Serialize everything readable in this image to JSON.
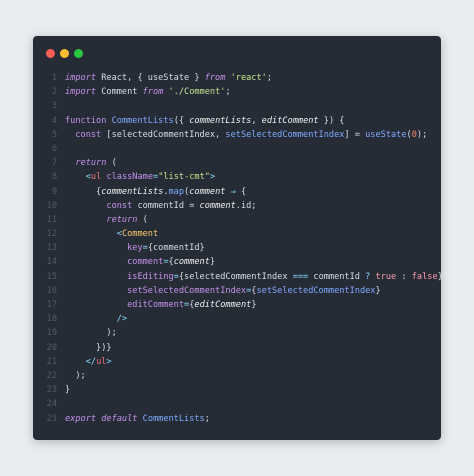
{
  "window": {
    "traffic_lights": [
      {
        "name": "close",
        "color": "#ff5f56"
      },
      {
        "name": "minimize",
        "color": "#ffbd2e"
      },
      {
        "name": "maximize",
        "color": "#27c93f"
      }
    ]
  },
  "code": {
    "lines": [
      {
        "n": "1",
        "tokens": [
          [
            "kw",
            "import"
          ],
          [
            "plain",
            " React, { useState } "
          ],
          [
            "kw",
            "from"
          ],
          [
            "plain",
            " "
          ],
          [
            "str",
            "'react'"
          ],
          [
            "plain",
            ";"
          ]
        ]
      },
      {
        "n": "2",
        "tokens": [
          [
            "kw",
            "import"
          ],
          [
            "plain",
            " Comment "
          ],
          [
            "kw",
            "from"
          ],
          [
            "plain",
            " "
          ],
          [
            "str",
            "'./Comment'"
          ],
          [
            "plain",
            ";"
          ]
        ]
      },
      {
        "n": "3",
        "tokens": []
      },
      {
        "n": "4",
        "tokens": [
          [
            "kw2",
            "function"
          ],
          [
            "plain",
            " "
          ],
          [
            "fn",
            "CommentLists"
          ],
          [
            "plain",
            "({ "
          ],
          [
            "param",
            "commentLists"
          ],
          [
            "plain",
            ", "
          ],
          [
            "param",
            "editComment"
          ],
          [
            "plain",
            " }) {"
          ]
        ]
      },
      {
        "n": "5",
        "tokens": [
          [
            "plain",
            "  "
          ],
          [
            "kw2",
            "const"
          ],
          [
            "plain",
            " [selectedCommentIndex, "
          ],
          [
            "fn",
            "setSelectedCommentIndex"
          ],
          [
            "plain",
            "] = "
          ],
          [
            "fn",
            "useState"
          ],
          [
            "plain",
            "("
          ],
          [
            "num",
            "0"
          ],
          [
            "plain",
            ");"
          ]
        ]
      },
      {
        "n": "6",
        "tokens": []
      },
      {
        "n": "7",
        "tokens": [
          [
            "plain",
            "  "
          ],
          [
            "kw",
            "return"
          ],
          [
            "plain",
            " ("
          ]
        ]
      },
      {
        "n": "8",
        "tokens": [
          [
            "plain",
            "    "
          ],
          [
            "punc",
            "<"
          ],
          [
            "tag",
            "ul"
          ],
          [
            "plain",
            " "
          ],
          [
            "attr",
            "className"
          ],
          [
            "punc",
            "="
          ],
          [
            "str",
            "\"list-cmt\""
          ],
          [
            "punc",
            ">"
          ]
        ]
      },
      {
        "n": "9",
        "tokens": [
          [
            "plain",
            "      {"
          ],
          [
            "param",
            "commentLists"
          ],
          [
            "plain",
            "."
          ],
          [
            "fn",
            "map"
          ],
          [
            "plain",
            "("
          ],
          [
            "param",
            "comment"
          ],
          [
            "plain",
            " "
          ],
          [
            "punc",
            "⇒"
          ],
          [
            "plain",
            " {"
          ]
        ]
      },
      {
        "n": "10",
        "tokens": [
          [
            "plain",
            "        "
          ],
          [
            "kw2",
            "const"
          ],
          [
            "plain",
            " commentId = "
          ],
          [
            "param",
            "comment"
          ],
          [
            "plain",
            ".id;"
          ]
        ]
      },
      {
        "n": "11",
        "tokens": [
          [
            "plain",
            "        "
          ],
          [
            "kw",
            "return"
          ],
          [
            "plain",
            " ("
          ]
        ]
      },
      {
        "n": "12",
        "tokens": [
          [
            "plain",
            "          "
          ],
          [
            "punc",
            "<"
          ],
          [
            "comp",
            "Comment"
          ]
        ]
      },
      {
        "n": "13",
        "tokens": [
          [
            "plain",
            "            "
          ],
          [
            "attr",
            "key"
          ],
          [
            "punc",
            "="
          ],
          [
            "plain",
            "{commentId}"
          ]
        ]
      },
      {
        "n": "14",
        "tokens": [
          [
            "plain",
            "            "
          ],
          [
            "attr",
            "comment"
          ],
          [
            "punc",
            "="
          ],
          [
            "plain",
            "{"
          ],
          [
            "param",
            "comment"
          ],
          [
            "plain",
            "}"
          ]
        ]
      },
      {
        "n": "15",
        "tokens": [
          [
            "plain",
            "            "
          ],
          [
            "attr",
            "isEditing"
          ],
          [
            "punc",
            "="
          ],
          [
            "plain",
            "{selectedCommentIndex "
          ],
          [
            "punc",
            "==="
          ],
          [
            "plain",
            " commentId "
          ],
          [
            "punc",
            "?"
          ],
          [
            "plain",
            " "
          ],
          [
            "bool",
            "true"
          ],
          [
            "plain",
            " : "
          ],
          [
            "bool",
            "false"
          ],
          [
            "plain",
            "}"
          ]
        ]
      },
      {
        "n": "16",
        "tokens": [
          [
            "plain",
            "            "
          ],
          [
            "attr",
            "setSelectedCommentIndex"
          ],
          [
            "punc",
            "="
          ],
          [
            "plain",
            "{"
          ],
          [
            "fn",
            "setSelectedCommentIndex"
          ],
          [
            "plain",
            "}"
          ]
        ]
      },
      {
        "n": "17",
        "tokens": [
          [
            "plain",
            "            "
          ],
          [
            "attr",
            "editComment"
          ],
          [
            "punc",
            "="
          ],
          [
            "plain",
            "{"
          ],
          [
            "param",
            "editComment"
          ],
          [
            "plain",
            "}"
          ]
        ]
      },
      {
        "n": "18",
        "tokens": [
          [
            "plain",
            "          "
          ],
          [
            "punc",
            "/>"
          ]
        ]
      },
      {
        "n": "19",
        "tokens": [
          [
            "plain",
            "        );"
          ]
        ]
      },
      {
        "n": "20",
        "tokens": [
          [
            "plain",
            "      })}"
          ]
        ]
      },
      {
        "n": "21",
        "tokens": [
          [
            "plain",
            "    "
          ],
          [
            "punc",
            "</"
          ],
          [
            "tag",
            "ul"
          ],
          [
            "punc",
            ">"
          ]
        ]
      },
      {
        "n": "22",
        "tokens": [
          [
            "plain",
            "  );"
          ]
        ]
      },
      {
        "n": "23",
        "tokens": [
          [
            "plain",
            "}"
          ]
        ]
      },
      {
        "n": "24",
        "tokens": []
      },
      {
        "n": "25",
        "tokens": [
          [
            "kw",
            "export"
          ],
          [
            "plain",
            " "
          ],
          [
            "kw",
            "default"
          ],
          [
            "plain",
            " "
          ],
          [
            "fn",
            "CommentLists"
          ],
          [
            "plain",
            ";"
          ]
        ]
      }
    ]
  }
}
